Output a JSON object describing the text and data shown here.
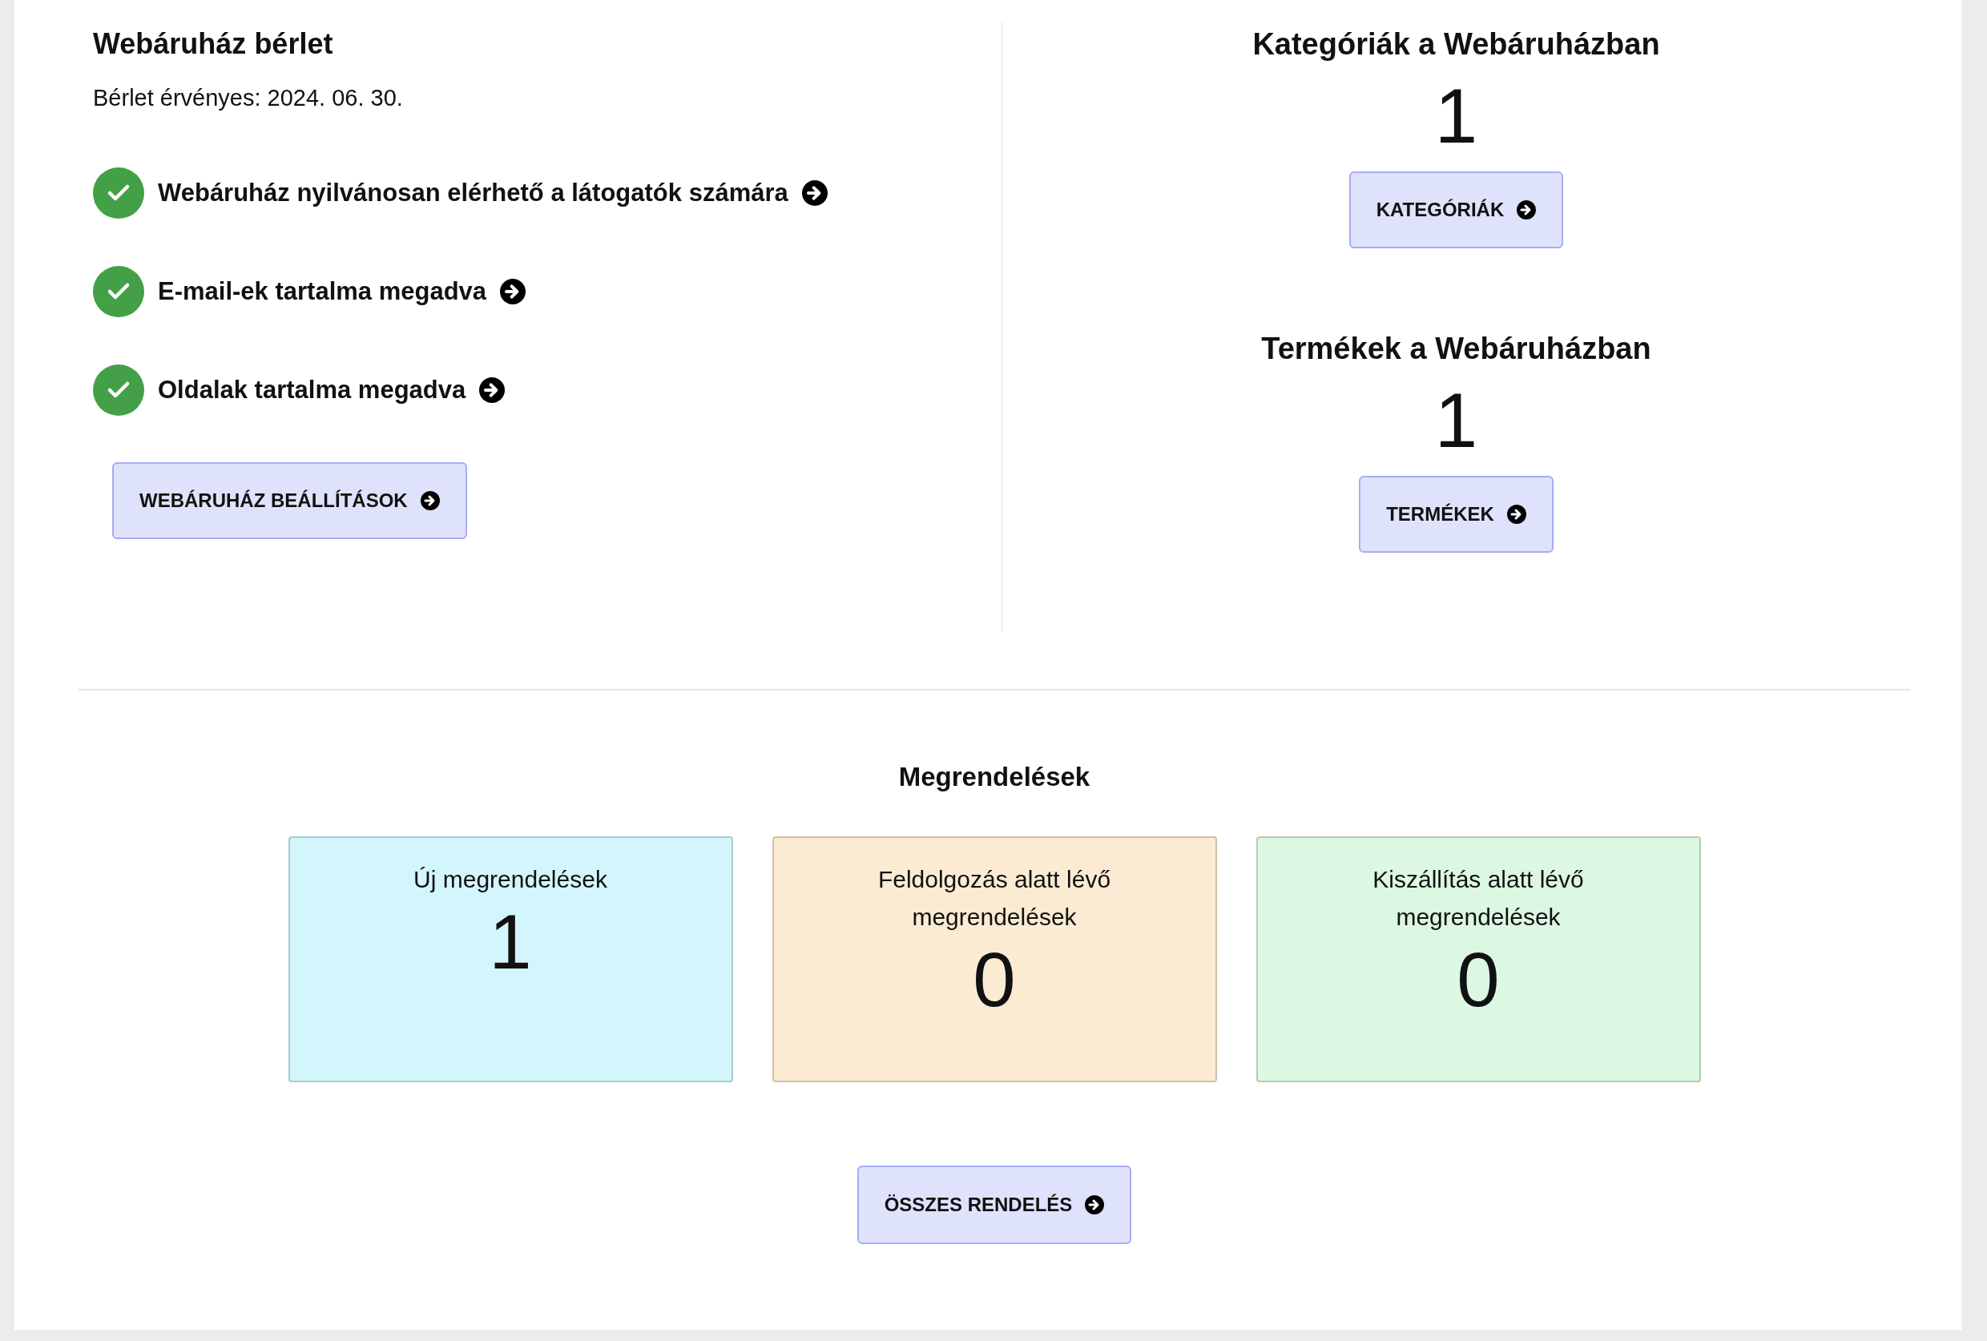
{
  "subscription": {
    "title": "Webáruház bérlet",
    "validity": "Bérlet érvényes: 2024. 06. 30.",
    "checklist": [
      {
        "label": "Webáruház nyilvánosan elérhető a látogatók számára",
        "checked": true
      },
      {
        "label": "E-mail-ek tartalma megadva",
        "checked": true
      },
      {
        "label": "Oldalak tartalma megadva",
        "checked": true
      }
    ],
    "button": "WEBÁRUHÁZ BEÁLLÍTÁSOK"
  },
  "stats": [
    {
      "title": "Kategóriák a Webáruházban",
      "count": "1",
      "button": "KATEGÓRIÁK"
    },
    {
      "title": "Termékek a Webáruházban",
      "count": "1",
      "button": "TERMÉKEK"
    }
  ],
  "orders": {
    "title": "Megrendelések",
    "cards": [
      {
        "label": "Új megrendelések",
        "count": "1",
        "color": "#d3f6fc"
      },
      {
        "label": "Feldolgozás alatt lévő megrendelések",
        "count": "0",
        "color": "#fbebd3"
      },
      {
        "label": "Kiszállítás alatt lévő megrendelések",
        "count": "0",
        "color": "#dcf8e3"
      }
    ],
    "button": "ÖSSZES RENDELÉS"
  }
}
